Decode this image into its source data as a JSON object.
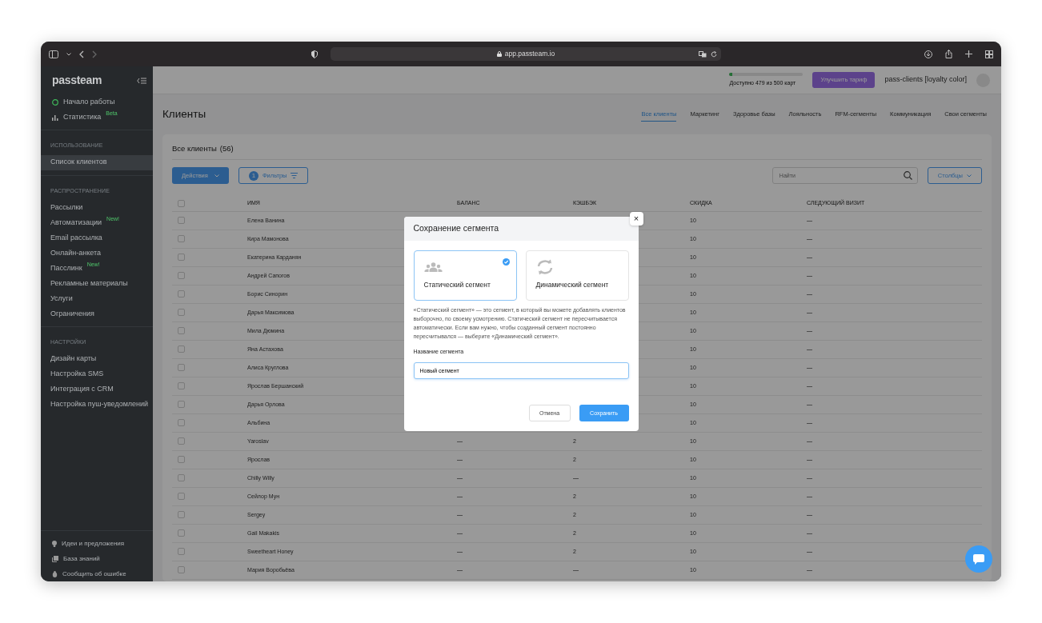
{
  "browser": {
    "url": "app.passteam.io"
  },
  "sidebar": {
    "logo": "passteam",
    "top_items": [
      {
        "label": "Начало работы",
        "selected": false
      },
      {
        "label": "Статистика",
        "badge": "Beta",
        "selected": false
      }
    ],
    "sections": [
      {
        "heading": "ИСПОЛЬЗОВАНИЕ",
        "items": [
          {
            "label": "Список клиентов",
            "selected": true
          }
        ]
      },
      {
        "heading": "РАСПРОСТРАНЕНИЕ",
        "items": [
          {
            "label": "Рассылки",
            "selected": false
          },
          {
            "label": "Автоматизации",
            "badge": "New!",
            "selected": false
          },
          {
            "label": "Email рассылка",
            "selected": false
          },
          {
            "label": "Онлайн-анкета",
            "selected": false
          },
          {
            "label": "Пасслинк",
            "badge": "New!",
            "selected": false
          },
          {
            "label": "Рекламные материалы",
            "selected": false
          },
          {
            "label": "Услуги",
            "selected": false
          },
          {
            "label": "Ограничения",
            "selected": false
          }
        ]
      },
      {
        "heading": "НАСТРОЙКИ",
        "items": [
          {
            "label": "Дизайн карты",
            "selected": false
          },
          {
            "label": "Настройка SMS",
            "selected": false
          },
          {
            "label": "Интеграция с CRM",
            "selected": false
          },
          {
            "label": "Настройка пуш-уведомлений",
            "selected": false
          }
        ]
      }
    ],
    "footer_items": [
      {
        "label": "Идеи и предложения"
      },
      {
        "label": "База знаний"
      },
      {
        "label": "Сообщить об ошибке"
      }
    ]
  },
  "topbar": {
    "quota": "Доступно 479 из 500 карт",
    "level": 0.04,
    "upgrade_button": "Улучшить тариф",
    "account": "pass-clients [loyalty color]"
  },
  "page": {
    "title": "Клиенты",
    "tabs": [
      {
        "label": "Все клиенты",
        "selected": true
      },
      {
        "label": "Маркетинг",
        "selected": false
      },
      {
        "label": "Здоровье базы",
        "selected": false
      },
      {
        "label": "Лояльность",
        "selected": false
      },
      {
        "label": "RFM-сегменты",
        "selected": false
      },
      {
        "label": "Коммуникация",
        "selected": false
      },
      {
        "label": "Свои сегменты",
        "selected": false
      }
    ]
  },
  "card": {
    "title": "Все клиенты",
    "count": "(56)",
    "actions_button": "Действия",
    "filters_badge": "1",
    "filters_button": "Фильтры",
    "search_placeholder": "Найти",
    "columns_button": "Столбцы"
  },
  "table": {
    "header_checked": false,
    "columns": [
      "ИМЯ",
      "БАЛАНС",
      "КЭШБЭК",
      "СКИДКА",
      "СЛЕДУЮЩИЙ ВИЗИТ"
    ],
    "rows": [
      {
        "checked": false,
        "name": "Елена Ванина",
        "discount": "10",
        "next_visit": "—"
      },
      {
        "checked": false,
        "name": "Кира Мамонова",
        "discount": "10",
        "next_visit": "—"
      },
      {
        "checked": false,
        "name": "Екатерина Карданян",
        "discount": "10",
        "next_visit": "—"
      },
      {
        "checked": false,
        "name": "Андрей Сапогов",
        "discount": "10",
        "next_visit": "—"
      },
      {
        "checked": false,
        "name": "Борис Синорин",
        "discount": "10",
        "next_visit": "—"
      },
      {
        "checked": false,
        "name": "Дарья Максимова",
        "discount": "10",
        "next_visit": "—"
      },
      {
        "checked": false,
        "name": "Мила Дюмина",
        "discount": "10",
        "next_visit": "—"
      },
      {
        "checked": false,
        "name": "Яна Астахова",
        "discount": "10",
        "next_visit": "—"
      },
      {
        "checked": false,
        "name": "Алиса Круглова",
        "discount": "10",
        "next_visit": "—"
      },
      {
        "checked": false,
        "name": "Ярослав Бершанский",
        "discount": "10",
        "next_visit": "—"
      },
      {
        "checked": false,
        "name": "Дарья Орлова",
        "discount": "10",
        "next_visit": "—"
      },
      {
        "checked": false,
        "name": "Альбина",
        "discount": "10",
        "next_visit": "—"
      },
      {
        "checked": false,
        "name": "Yaroslav",
        "balance": "—",
        "cashback": "2",
        "discount": "10",
        "next_visit": "—"
      },
      {
        "checked": false,
        "name": "Ярослав",
        "balance": "—",
        "cashback": "2",
        "discount": "10",
        "next_visit": "—"
      },
      {
        "checked": false,
        "name": "Chilly Willy",
        "balance": "—",
        "cashback": "—",
        "discount": "10",
        "next_visit": "—"
      },
      {
        "checked": false,
        "name": "Сейлор Мун",
        "balance": "—",
        "cashback": "2",
        "discount": "10",
        "next_visit": "—"
      },
      {
        "checked": false,
        "name": "Sergey",
        "balance": "—",
        "cashback": "2",
        "discount": "10",
        "next_visit": "—"
      },
      {
        "checked": false,
        "name": "Gail Makakis",
        "balance": "—",
        "cashback": "2",
        "discount": "10",
        "next_visit": "—"
      },
      {
        "checked": false,
        "name": "Sweetheart Honey",
        "balance": "—",
        "cashback": "2",
        "discount": "10",
        "next_visit": "—"
      },
      {
        "checked": false,
        "name": "Мария Воробьёва",
        "balance": "—",
        "cashback": "—",
        "discount": "10",
        "next_visit": "—"
      }
    ]
  },
  "modal": {
    "title": "Сохранение сегмента",
    "close": "×",
    "options": [
      {
        "kind": "static",
        "label": "Статический сегмент",
        "selected": true
      },
      {
        "kind": "dynamic",
        "label": "Динамический сегмент",
        "selected": false
      }
    ],
    "description": "«Статический сегмент» — это сегмент, в который вы можете добавлять клиентов выборочно, по своему усмотрению. Статический сегмент не пересчитывается автоматически. Если вам нужно, чтобы созданный сегмент постоянно пересчитывался — выберите «Динамический сегмент».",
    "field_label": "Название сегмента",
    "field_value": "Новый сегмент",
    "cancel_button": "Отмена",
    "save_button": "Сохранить"
  }
}
